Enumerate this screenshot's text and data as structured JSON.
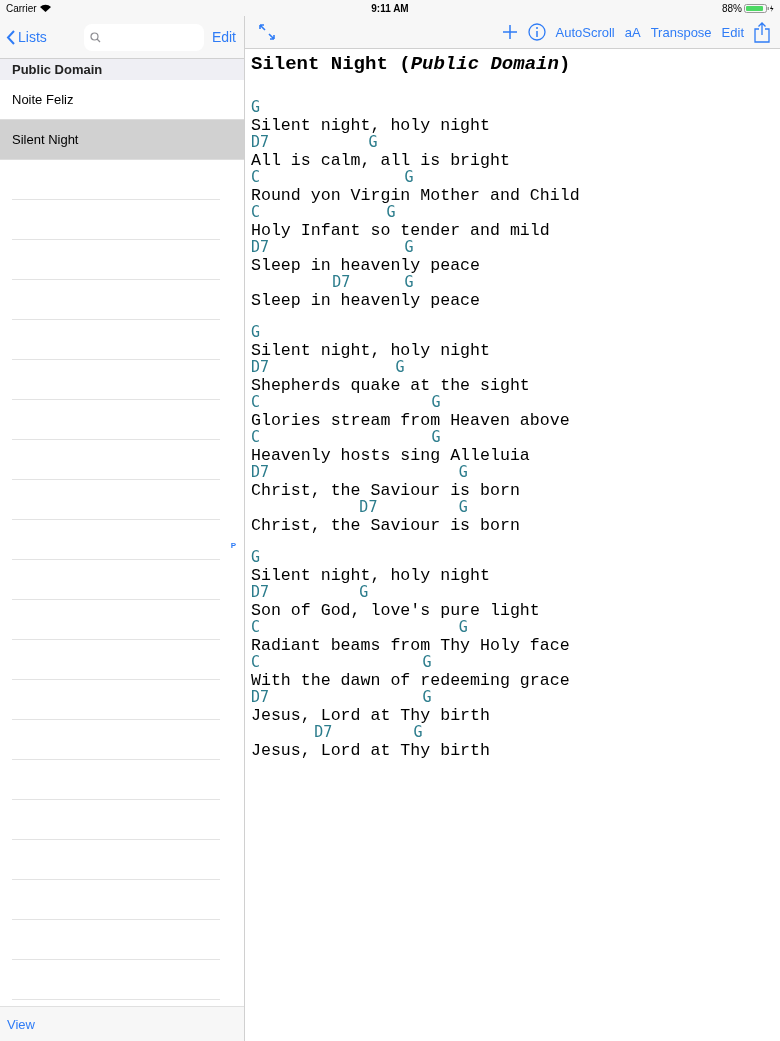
{
  "status_bar": {
    "carrier": "Carrier",
    "time": "9:11 AM",
    "battery": "88%"
  },
  "sidebar": {
    "back_button": "Lists",
    "edit_button": "Edit",
    "section": "Public Domain",
    "items": [
      {
        "title": "Noite Feliz",
        "selected": false
      },
      {
        "title": "Silent Night",
        "selected": true
      }
    ],
    "index_letters": [
      "P"
    ],
    "toolbar_button": "View"
  },
  "song_toolbar": {
    "buttons": [
      "AutoScroll",
      "aA",
      "Transpose",
      "Edit"
    ]
  },
  "song": {
    "title": "Silent Night (*Public Domain*)",
    "verses": [
      {
        "lines": [
          {
            "chords": "G",
            "lyric": "Silent night, holy night"
          },
          {
            "chords": "D7           G",
            "lyric": "All is calm, all is bright"
          },
          {
            "chords": "C                G",
            "lyric": "Round yon Virgin Mother and Child"
          },
          {
            "chords": "C              G",
            "lyric": "Holy Infant so tender and mild"
          },
          {
            "chords": "D7               G",
            "lyric": "Sleep in heavenly peace"
          },
          {
            "chords": "         D7      G",
            "lyric": "Sleep in heavenly peace"
          }
        ]
      },
      {
        "lines": [
          {
            "chords": "G",
            "lyric": "Silent night, holy night"
          },
          {
            "chords": "D7              G",
            "lyric": "Shepherds quake at the sight"
          },
          {
            "chords": "C                   G",
            "lyric": "Glories stream from Heaven above"
          },
          {
            "chords": "C                   G",
            "lyric": "Heavenly hosts sing Alleluia"
          },
          {
            "chords": "D7                     G",
            "lyric": "Christ, the Saviour is born"
          },
          {
            "chords": "            D7         G",
            "lyric": "Christ, the Saviour is born"
          }
        ]
      },
      {
        "lines": [
          {
            "chords": "G",
            "lyric": "Silent night, holy night"
          },
          {
            "chords": "D7          G",
            "lyric": "Son of God, love's pure light"
          },
          {
            "chords": "C                      G",
            "lyric": "Radiant beams from Thy Holy face"
          },
          {
            "chords": "C                  G",
            "lyric": "With the dawn of redeeming grace"
          },
          {
            "chords": "D7                 G",
            "lyric": "Jesus, Lord at Thy birth"
          },
          {
            "chords": "       D7         G",
            "lyric": "Jesus, Lord at Thy birth"
          }
        ]
      }
    ]
  }
}
